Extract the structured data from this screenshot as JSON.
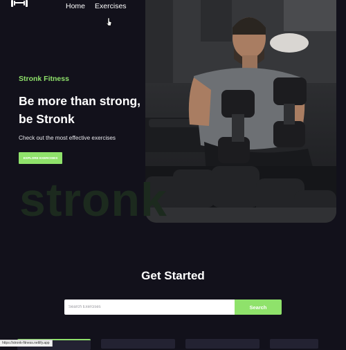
{
  "nav": {
    "logo_icon": "dumbbell-logo-icon",
    "items": [
      {
        "label": "Home"
      },
      {
        "label": "Exercises"
      }
    ]
  },
  "hero": {
    "brand": "Stronk Fitness",
    "headline": "Be more than strong, be Stronk",
    "subtext": "Check out the most effective exercises",
    "cta_label": "EXPLORE EXERCISES",
    "watermark": "stronk",
    "photo_icon": "athlete-with-dumbbells-photo"
  },
  "search_section": {
    "title": "Get Started",
    "placeholder": "Search Exercises",
    "button_label": "Search"
  },
  "status_bar": {
    "url": "https://stronk-fitness.netlify.app"
  },
  "colors": {
    "accent": "#8fe26b",
    "background": "#12111b",
    "card": "#232232"
  }
}
